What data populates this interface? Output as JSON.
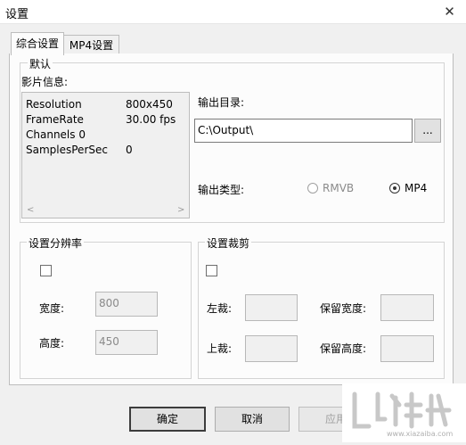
{
  "window": {
    "title": "设置",
    "close_glyph": "✕"
  },
  "tabs": [
    {
      "label": "综合设置",
      "active": true
    },
    {
      "label": "MP4设置",
      "active": false
    }
  ],
  "default_group": {
    "legend": "默认",
    "movie_info_label": "影片信息:",
    "info_rows": [
      {
        "key": "Resolution",
        "value": "800x450"
      },
      {
        "key": "FrameRate",
        "value": "30.00 fps"
      },
      {
        "key": "Channels 0",
        "value": ""
      },
      {
        "key": "SamplesPerSec",
        "value": "0"
      }
    ],
    "output_dir_label": "输出目录:",
    "output_dir_value": "C:\\Output\\",
    "browse_label": "...",
    "output_type_label": "输出类型:",
    "output_types": [
      {
        "label": "RMVB",
        "selected": false,
        "enabled": false
      },
      {
        "label": "MP4",
        "selected": true,
        "enabled": true
      }
    ]
  },
  "resolution_group": {
    "legend": "设置分辨率",
    "width_label": "宽度:",
    "width_value": "800",
    "height_label": "高度:",
    "height_value": "450"
  },
  "crop_group": {
    "legend": "设置裁剪",
    "left_label": "左裁:",
    "top_label": "上裁:",
    "keep_width_label": "保留宽度:",
    "keep_height_label": "保留高度:"
  },
  "buttons": {
    "ok": "确定",
    "cancel": "取消",
    "apply": "应用"
  },
  "watermark": {
    "site": "www.xiazaiba.com"
  }
}
